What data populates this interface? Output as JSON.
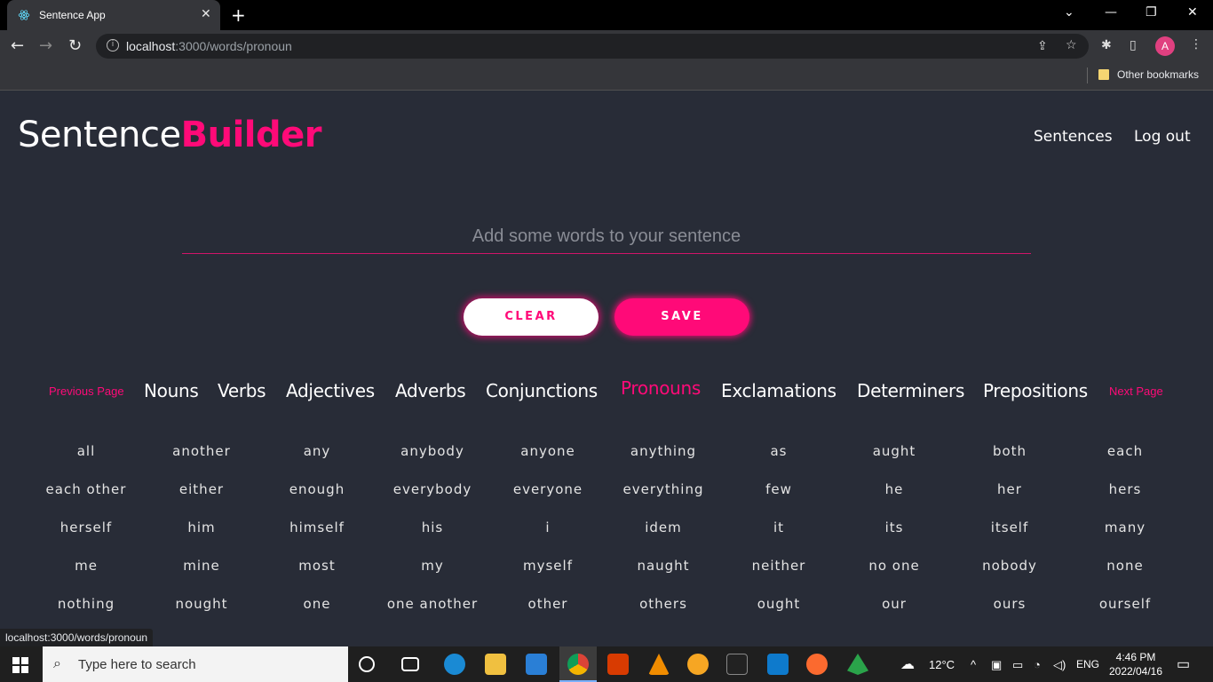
{
  "browser": {
    "tab_title": "Sentence App",
    "url_host": "localhost",
    "url_path": ":3000/words/pronoun",
    "bookmark_label": "Other bookmarks",
    "avatar_letter": "A",
    "status_url": "localhost:3000/words/pronoun"
  },
  "app": {
    "brand_part1": "Sentence",
    "brand_part2": "Builder",
    "nav": {
      "sentences": "Sentences",
      "logout": "Log out"
    },
    "input_placeholder": "Add some words to your sentence",
    "clear_label": "CLEAR",
    "save_label": "SAVE",
    "accent_color": "#ff0a78",
    "previous_page": "Previous Page",
    "next_page": "Next Page",
    "categories": [
      "Nouns",
      "Verbs",
      "Adjectives",
      "Adverbs",
      "Conjunctions",
      "Pronouns",
      "Exclamations",
      "Determiners",
      "Prepositions"
    ],
    "active_category": "Pronouns",
    "words": [
      [
        "all",
        "another",
        "any",
        "anybody",
        "anyone",
        "anything",
        "as",
        "aught",
        "both",
        "each"
      ],
      [
        "each other",
        "either",
        "enough",
        "everybody",
        "everyone",
        "everything",
        "few",
        "he",
        "her",
        "hers"
      ],
      [
        "herself",
        "him",
        "himself",
        "his",
        "i",
        "idem",
        "it",
        "its",
        "itself",
        "many"
      ],
      [
        "me",
        "mine",
        "most",
        "my",
        "myself",
        "naught",
        "neither",
        "no one",
        "nobody",
        "none"
      ],
      [
        "nothing",
        "nought",
        "one",
        "one another",
        "other",
        "others",
        "ought",
        "our",
        "ours",
        "ourself"
      ]
    ]
  },
  "taskbar": {
    "search_placeholder": "Type here to search",
    "weather": "12°C",
    "language": "ENG",
    "time": "4:46 PM",
    "date": "2022/04/16"
  }
}
